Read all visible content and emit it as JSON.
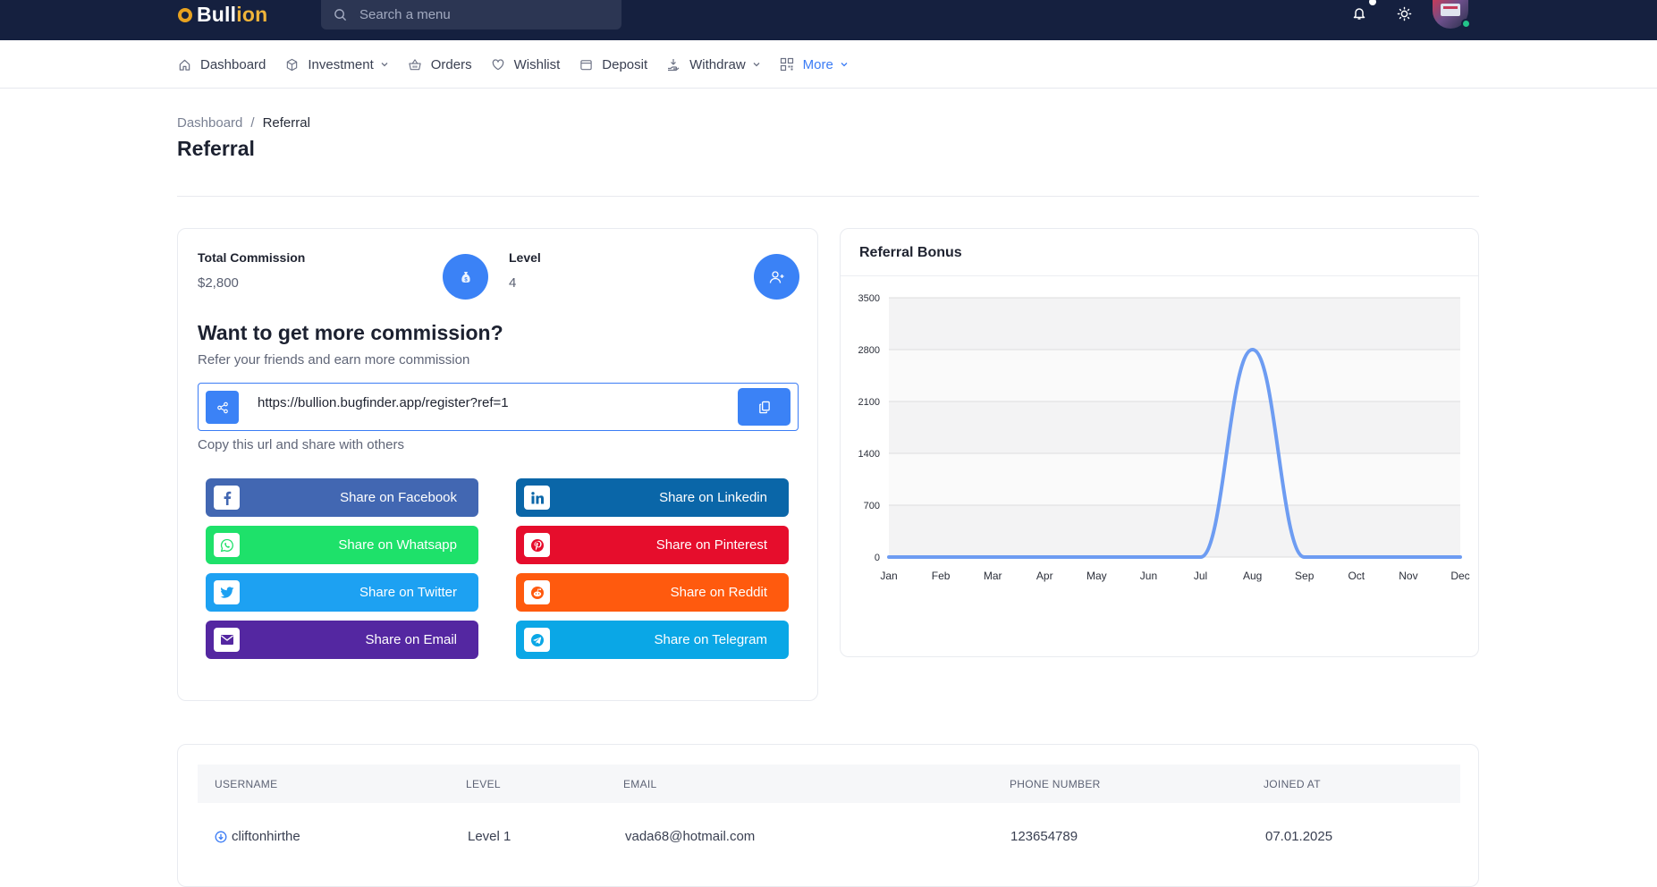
{
  "app": {
    "logo_part1": "Bull",
    "logo_part2": "ion"
  },
  "search": {
    "placeholder": "Search a menu"
  },
  "nav": {
    "items": [
      {
        "label": "Dashboard",
        "icon": "home-icon",
        "dropdown": false
      },
      {
        "label": "Investment",
        "icon": "box-icon",
        "dropdown": true
      },
      {
        "label": "Orders",
        "icon": "basket-icon",
        "dropdown": false
      },
      {
        "label": "Wishlist",
        "icon": "heart-icon",
        "dropdown": false
      },
      {
        "label": "Deposit",
        "icon": "wallet-icon",
        "dropdown": false
      },
      {
        "label": "Withdraw",
        "icon": "withdraw-icon",
        "dropdown": true
      },
      {
        "label": "More",
        "icon": "grid-icon",
        "dropdown": true,
        "active": true
      }
    ]
  },
  "breadcrumb": {
    "root": "Dashboard",
    "separator": "/",
    "current": "Referral"
  },
  "page": {
    "title": "Referral"
  },
  "stats": {
    "commission": {
      "label": "Total Commission",
      "value": "$2,800"
    },
    "level": {
      "label": "Level",
      "value": "4"
    }
  },
  "promo": {
    "title": "Want to get more commission?",
    "subtitle": "Refer your friends and earn more commission",
    "url": "https://bullion.bugfinder.app/register?ref=1",
    "hint": "Copy this url and share with others"
  },
  "share": [
    {
      "label": "Share on Facebook",
      "icon": "facebook-icon",
      "color": "#4267b2"
    },
    {
      "label": "Share on Linkedin",
      "icon": "linkedin-icon",
      "color": "#0a66a8"
    },
    {
      "label": "Share on Whatsapp",
      "icon": "whatsapp-icon",
      "color": "#1ee16a"
    },
    {
      "label": "Share on Pinterest",
      "icon": "pinterest-icon",
      "color": "#e60d2c"
    },
    {
      "label": "Share on Twitter",
      "icon": "twitter-icon",
      "color": "#1da1f2"
    },
    {
      "label": "Share on Reddit",
      "icon": "reddit-icon",
      "color": "#ff5a0e"
    },
    {
      "label": "Share on Email",
      "icon": "email-icon",
      "color": "#5427a1"
    },
    {
      "label": "Share on Telegram",
      "icon": "telegram-icon",
      "color": "#0aa7e6"
    }
  ],
  "chart_card": {
    "title": "Referral Bonus"
  },
  "chart_data": {
    "type": "area",
    "title": "Referral Bonus",
    "categories": [
      "Jan",
      "Feb",
      "Mar",
      "Apr",
      "May",
      "Jun",
      "Jul",
      "Aug",
      "Sep",
      "Oct",
      "Nov",
      "Dec"
    ],
    "values": [
      0,
      0,
      0,
      0,
      0,
      0,
      0,
      2800,
      0,
      0,
      0,
      0
    ],
    "ylim": [
      0,
      3500
    ],
    "yticks": [
      0,
      700,
      1400,
      2100,
      2800,
      3500
    ],
    "grid": true,
    "line_color": "#6d9cf2"
  },
  "table": {
    "columns": [
      "USERNAME",
      "LEVEL",
      "EMAIL",
      "PHONE NUMBER",
      "JOINED AT"
    ],
    "rows": [
      {
        "username": "cliftonhirthe",
        "level": "Level 1",
        "email": "vada68@hotmail.com",
        "phone": "123654789",
        "joined": "07.01.2025"
      }
    ]
  },
  "colors": {
    "topbar": "#15203f",
    "accent": "#3b82f6",
    "active_nav": "#3b7cf5"
  }
}
